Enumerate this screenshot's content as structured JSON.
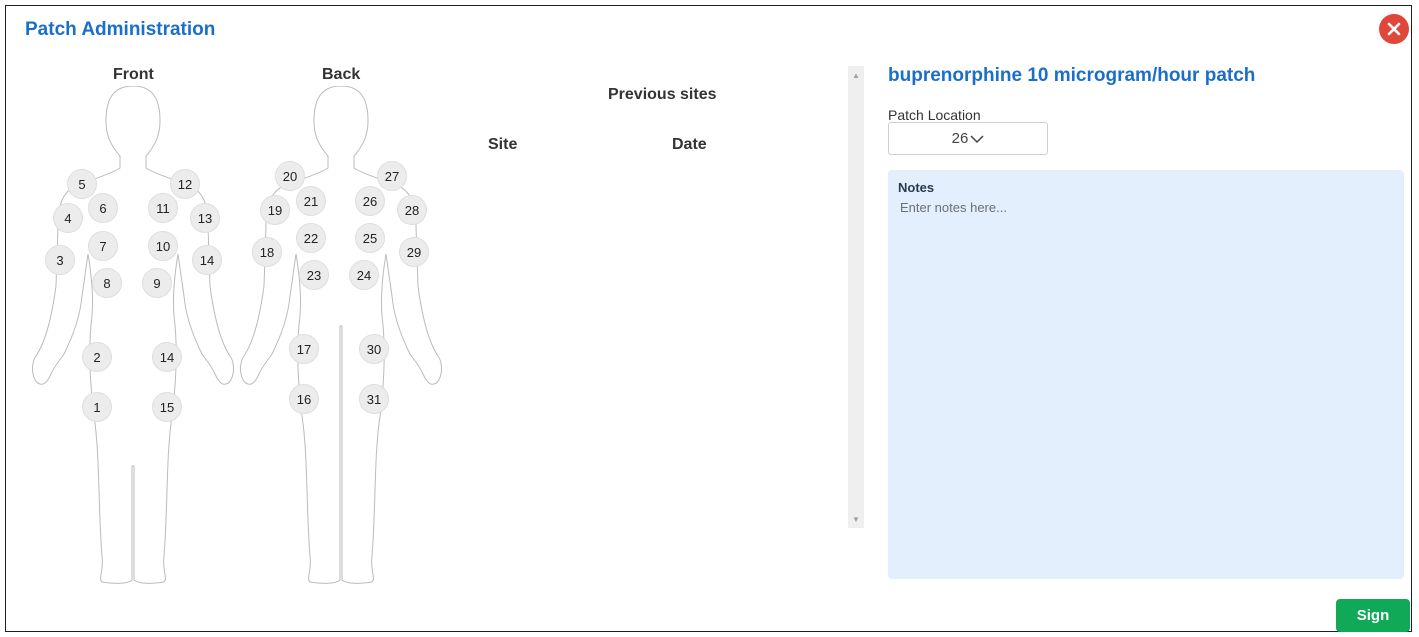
{
  "dialog": {
    "title": "Patch Administration"
  },
  "body_map": {
    "front_label": "Front",
    "back_label": "Back",
    "front_sites": [
      "1",
      "2",
      "3",
      "4",
      "5",
      "6",
      "7",
      "8",
      "9",
      "10",
      "11",
      "12",
      "13",
      "14",
      "14",
      "15"
    ],
    "back_sites": [
      "16",
      "17",
      "18",
      "19",
      "20",
      "21",
      "22",
      "23",
      "24",
      "25",
      "26",
      "27",
      "28",
      "29",
      "30",
      "31"
    ]
  },
  "previous_sites": {
    "title": "Previous sites",
    "site_header": "Site",
    "date_header": "Date"
  },
  "medication": {
    "name": "buprenorphine 10 microgram/hour patch",
    "location_label": "Patch Location",
    "location_value": "26"
  },
  "notes": {
    "label": "Notes",
    "placeholder": "Enter notes here..."
  },
  "actions": {
    "sign_label": "Sign"
  },
  "colors": {
    "title": "#1b6fc9",
    "close": "#e0463a",
    "sign": "#0fa958",
    "notes_bg": "#e3effc"
  },
  "icons": {
    "close": "close-icon",
    "dropdown": "chevron-down-icon"
  }
}
